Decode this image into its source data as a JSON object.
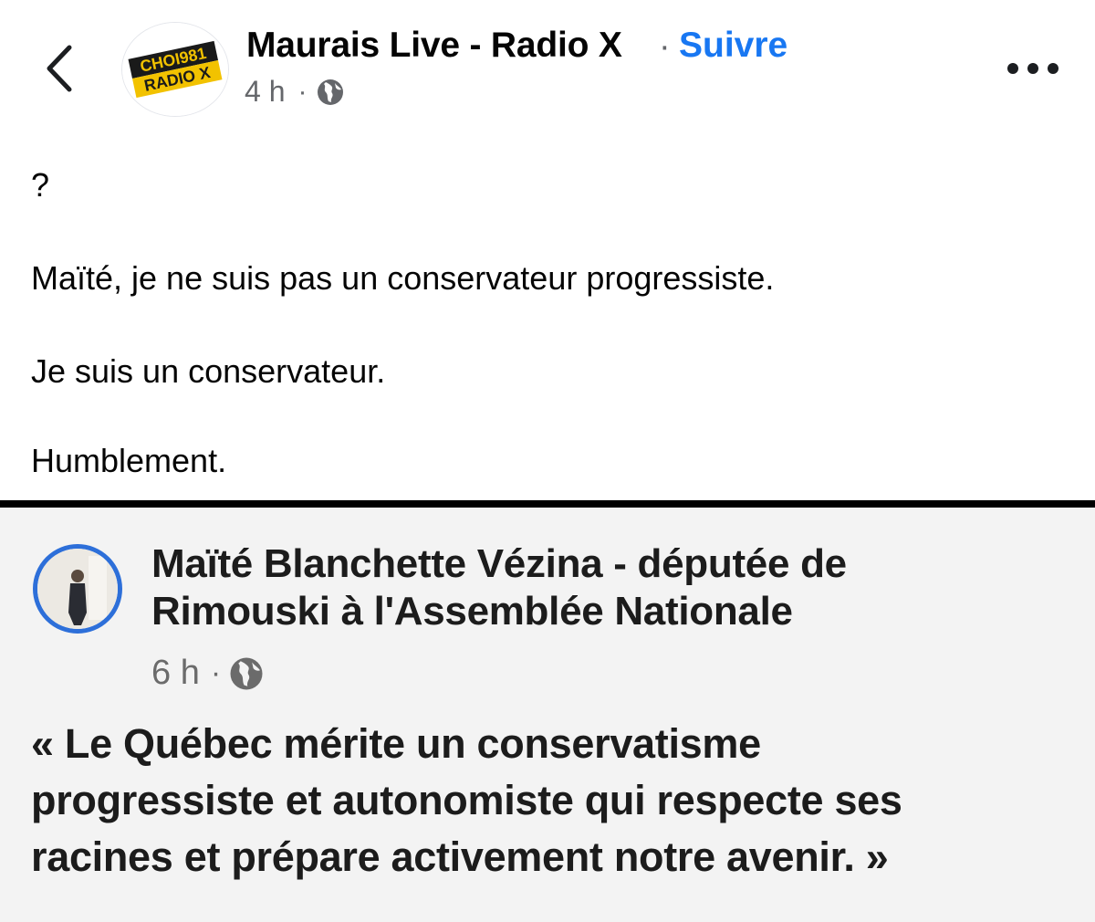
{
  "post": {
    "page_name": "Maurais Live - Radio X",
    "separator": "·",
    "follow_label": "Suivre",
    "time": "4 h",
    "meta_separator": "·",
    "avatar_logo_lines": [
      "CHOI981",
      "RADIO X"
    ],
    "text_lines": [
      "?",
      "Maïté, je ne suis pas un conservateur progressiste.",
      "Je suis un conservateur.",
      "Humblement."
    ],
    "icons": {
      "back": "chevron-left-icon",
      "privacy": "globe-icon",
      "more": "more-options-icon"
    },
    "accent_color": "#1877f2"
  },
  "shared_screenshot": {
    "author_lines": [
      "Maïté Blanchette Vézina - députée de",
      "Rimouski à l'Assemblée Nationale"
    ],
    "time": "6 h",
    "meta_separator": "·",
    "quote_lines": [
      "« Le Québec mérite un conservatisme",
      "progressiste et autonomiste qui respecte ses",
      "racines et prépare activement notre avenir. »"
    ],
    "avatar_ring_color": "#2d6fd9"
  }
}
